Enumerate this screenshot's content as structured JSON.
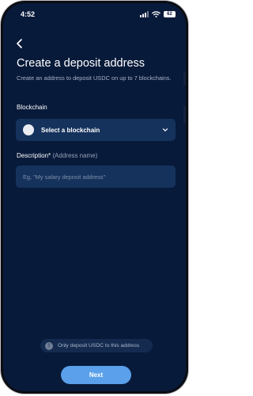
{
  "status_bar": {
    "time": "4:52",
    "battery": "62"
  },
  "page": {
    "title": "Create a deposit address",
    "subtitle": "Create an address to deposit USDC on up to 7 blockchains."
  },
  "blockchain": {
    "label": "Blockchain",
    "select_text": "Select a blockchain"
  },
  "description": {
    "label": "Description*",
    "label_note": "(Address name)",
    "placeholder": "Eg, \"My salary deposit address\""
  },
  "notice": {
    "text": "Only deposit USDC to this address"
  },
  "footer": {
    "next_label": "Next"
  },
  "icons": {
    "back": "chevron-left-icon",
    "dropdown": "chevron-down-icon",
    "notice": "info-icon",
    "signal": "signal-icon",
    "wifi": "wifi-icon",
    "battery": "battery-icon"
  },
  "colors": {
    "background": "#081a3a",
    "field": "#15325c",
    "accent": "#5aa0ea"
  }
}
